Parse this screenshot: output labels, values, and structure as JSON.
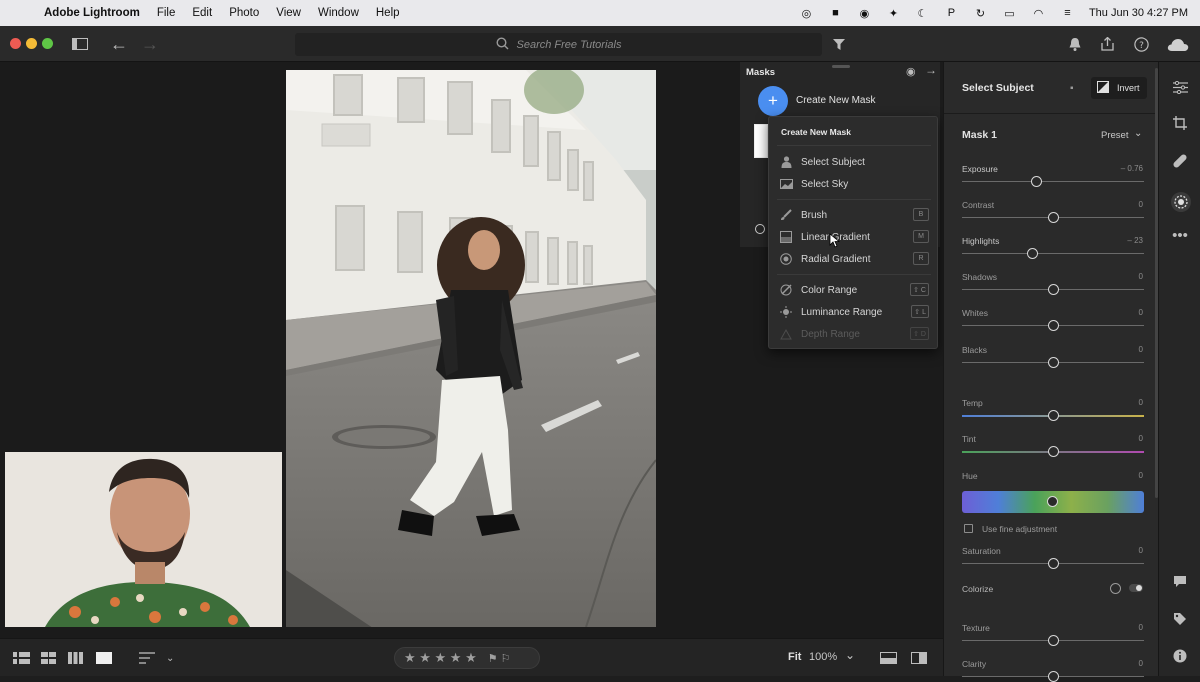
{
  "menubar": {
    "app_name": "Adobe Lightroom",
    "menus": [
      "File",
      "Edit",
      "Photo",
      "View",
      "Window",
      "Help"
    ],
    "clock": "Thu Jun 30  4:27 PM"
  },
  "toolbar": {
    "search_placeholder": "Search Free Tutorials"
  },
  "masks_panel": {
    "title": "Masks",
    "create_label": "Create New Mask"
  },
  "create_menu": {
    "heading": "Create New Mask",
    "items": [
      {
        "label": "Select Subject",
        "icon": "person-icon",
        "key": ""
      },
      {
        "label": "Select Sky",
        "icon": "sky-icon",
        "key": ""
      },
      {
        "label": "Brush",
        "icon": "brush-icon",
        "key": "B"
      },
      {
        "label": "Linear Gradient",
        "icon": "linear-gradient-icon",
        "key": "M"
      },
      {
        "label": "Radial Gradient",
        "icon": "radial-gradient-icon",
        "key": "R"
      },
      {
        "label": "Color Range",
        "icon": "color-range-icon",
        "key": "⇧ C"
      },
      {
        "label": "Luminance Range",
        "icon": "luminance-range-icon",
        "key": "⇧ L"
      },
      {
        "label": "Depth Range",
        "icon": "depth-range-icon",
        "key": "⇧ D",
        "disabled": true
      }
    ]
  },
  "right_panel": {
    "title": "Select Subject",
    "invert_label": "Invert",
    "mask_name": "Mask 1",
    "preset_label": "Preset",
    "sliders": [
      {
        "label": "Exposure",
        "value": "– 0.76",
        "pos": -0.18
      },
      {
        "label": "Contrast",
        "value": "0",
        "pos": 0
      },
      {
        "label": "Highlights",
        "value": "– 23",
        "pos": -0.23
      },
      {
        "label": "Shadows",
        "value": "0",
        "pos": 0
      },
      {
        "label": "Whites",
        "value": "0",
        "pos": 0
      },
      {
        "label": "Blacks",
        "value": "0",
        "pos": 0
      },
      {
        "label": "Temp",
        "value": "0",
        "pos": 0
      },
      {
        "label": "Tint",
        "value": "0",
        "pos": 0
      },
      {
        "label": "Hue",
        "value": "0",
        "pos": 0
      },
      {
        "label": "Saturation",
        "value": "0",
        "pos": 0
      },
      {
        "label": "Texture",
        "value": "0",
        "pos": 0
      },
      {
        "label": "Clarity",
        "value": "0",
        "pos": 0
      }
    ],
    "fine_adjust_label": "Use fine adjustment",
    "colorize_label": "Colorize"
  },
  "bottom_bar": {
    "fit_label": "Fit",
    "zoom": "100%",
    "stars": "★ ★ ★ ★ ★"
  },
  "colors": {
    "accent": "#4a8ef0",
    "panel_bg": "#2a2a2a",
    "menubar_bg": "#e9e9ec"
  }
}
